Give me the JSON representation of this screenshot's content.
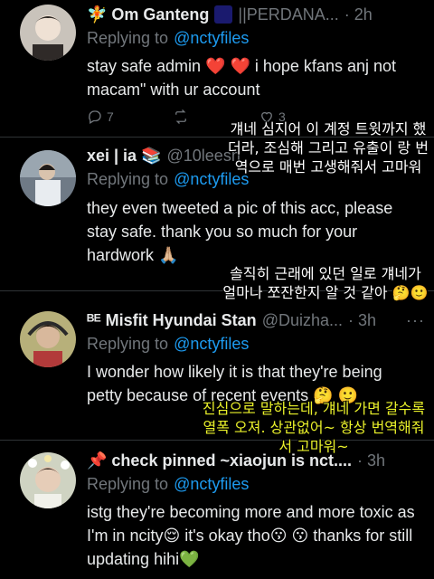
{
  "tweets": [
    {
      "name": "🧚 Om Ganteng",
      "handle": "||PERDANA...",
      "time": "· 2h",
      "reply_prefix": "Replying to",
      "reply_to": "@nctyfiles",
      "text": "stay safe admin ❤️ ❤️ i hope kfans anj not macam\" with ur account",
      "reply_count": "7",
      "retweet_count": "",
      "like_count": "3"
    },
    {
      "name": "xei | ia 📚",
      "handle": "@10leesh",
      "time": "",
      "reply_prefix": "Replying to",
      "reply_to": "@nctyfiles",
      "text": "they even tweeted a pic of this acc, please stay safe. thank you so much for your hardwork 🙏🏼"
    },
    {
      "name": "ᴮᴱ Misfit Hyundai Stan",
      "handle": "@Duizha...",
      "time": "· 3h",
      "reply_prefix": "Replying to",
      "reply_to": "@nctyfiles",
      "text": "I wonder how likely it is that they're being petty because of recent events 🤔 🙂"
    },
    {
      "name": "📌 check pinned ~xiaojun is nct....",
      "handle": "",
      "time": "· 3h",
      "reply_prefix": "Replying to",
      "reply_to": "@nctyfiles",
      "text": "istg they're becoming more and more toxic as I'm in ncity😌 it's okay tho😗 😗 thanks for still updating hihi💚"
    }
  ],
  "overlays": {
    "first": "걔네 심지어 이 계정 트윗까지 했더라, 조심해 그리고 유출이 랑 번역으로 매번 고생해줘서 고마워",
    "second": "솔직히 근래에 있던 일로 걔네가 얼마나 쪼잔한지 알 것 같아 🤔🙂",
    "third": "진심으로 말하는데, 걔네 가면 갈수록 열폭 오져. 상관없어~ 항상 번역해줘서 고마워~"
  },
  "icons": {
    "reply": "comment-icon",
    "retweet": "retweet-icon",
    "like": "heart-icon",
    "more": "more-dots-icon"
  },
  "colors": {
    "background": "#000000",
    "link": "#1d9bf0",
    "muted": "#71767b",
    "overlay_yellow": "#e9f02a"
  }
}
